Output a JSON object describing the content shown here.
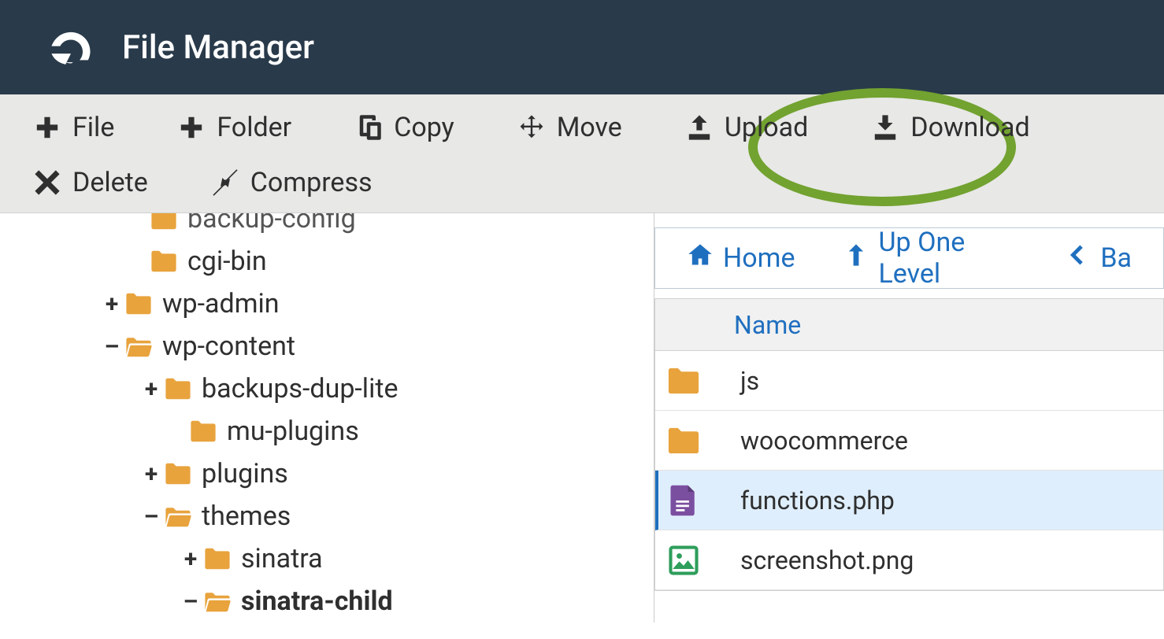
{
  "header": {
    "title": "File Manager"
  },
  "toolbar": {
    "file": "File",
    "folder": "Folder",
    "copy": "Copy",
    "move": "Move",
    "upload": "Upload",
    "download": "Download",
    "delete": "Delete",
    "compress": "Compress"
  },
  "tree": {
    "items": [
      {
        "expander": "",
        "indent": 160,
        "icon": "closed",
        "label": "backup-config",
        "cut": true
      },
      {
        "expander": "",
        "indent": 160,
        "icon": "closed",
        "label": "cgi-bin"
      },
      {
        "expander": "+",
        "indent": 128,
        "icon": "closed",
        "label": "wp-admin"
      },
      {
        "expander": "–",
        "indent": 128,
        "icon": "open",
        "label": "wp-content"
      },
      {
        "expander": "+",
        "indent": 178,
        "icon": "closed",
        "label": "backups-dup-lite"
      },
      {
        "expander": "",
        "indent": 210,
        "icon": "closed",
        "label": "mu-plugins"
      },
      {
        "expander": "+",
        "indent": 178,
        "icon": "closed",
        "label": "plugins"
      },
      {
        "expander": "–",
        "indent": 178,
        "icon": "open",
        "label": "themes"
      },
      {
        "expander": "+",
        "indent": 228,
        "icon": "closed",
        "label": "sinatra"
      },
      {
        "expander": "–",
        "indent": 228,
        "icon": "open",
        "label": "sinatra-child",
        "bold": true
      }
    ]
  },
  "breadcrumb": {
    "home": "Home",
    "up": "Up One Level",
    "back": "Ba"
  },
  "table": {
    "header_name": "Name",
    "rows": [
      {
        "type": "folder",
        "name": "js",
        "selected": false
      },
      {
        "type": "folder",
        "name": "woocommerce",
        "selected": false
      },
      {
        "type": "doc",
        "name": "functions.php",
        "selected": true
      },
      {
        "type": "image",
        "name": "screenshot.png",
        "selected": false
      }
    ]
  }
}
